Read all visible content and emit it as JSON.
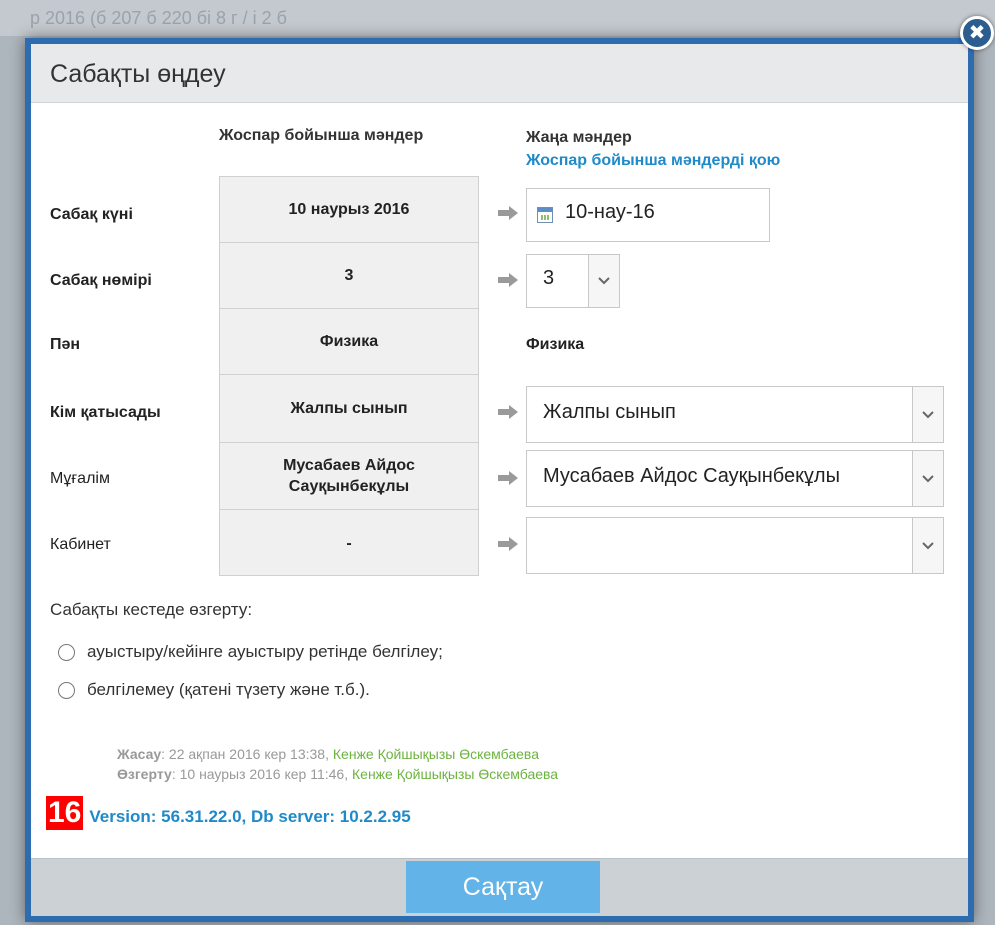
{
  "background": {
    "partial_text": "р 2016 (б      207    б     220          бі        8      г / і               2 б"
  },
  "dialog": {
    "title": "Сабақты өңдеу",
    "close_glyph": "✖",
    "col_plan_header": "Жоспар бойынша мәндер",
    "col_new_header": "Жаңа мәндер",
    "apply_plan_link": "Жоспар бойынша мәндерді қою",
    "rows": [
      {
        "label": "Сабақ күні",
        "plan": "10 наурыз 2016",
        "value": "10-нау-16"
      },
      {
        "label": "Сабақ нөмірі",
        "plan": "3",
        "value": "3"
      },
      {
        "label": "Пән",
        "plan": "Физика",
        "value": "Физика"
      },
      {
        "label": "Кім қатысады",
        "plan": "Жалпы сынып",
        "value": "Жалпы сынып"
      },
      {
        "label": "Мұғалім",
        "plan": "Мусабаев Айдос Сауқынбекұлы",
        "value": "Мусабаев Айдос Сауқынбекұлы"
      },
      {
        "label": "Кабинет",
        "plan": "-",
        "value": ""
      }
    ],
    "change_label": "Сабақты кестеде өзгерту:",
    "radio_options": [
      "ауыстыру/кейінге ауыстыру ретінде белгілеу;",
      "белгілемеу (қатені түзету және т.б.)."
    ],
    "created": {
      "label": "Жасау",
      "date": "22 ақпан 2016 кер 13:38,",
      "user": "Кенже Қойшықызы Өскембаева"
    },
    "modified": {
      "label": "Өзгерту",
      "date": "10 наурыз 2016 кер 11:46,",
      "user": "Кенже Қойшықызы Өскембаева"
    },
    "version_badge": "16",
    "version_text": "Version: 56.31.22.0, Db server: 10.2.2.95",
    "save_label": "Сақтау"
  },
  "colors": {
    "frame": "#2e6cb0",
    "link": "#1f8ac9",
    "user_link": "#6db33f",
    "save_button": "#62b4e8",
    "badge": "#ff0000"
  }
}
